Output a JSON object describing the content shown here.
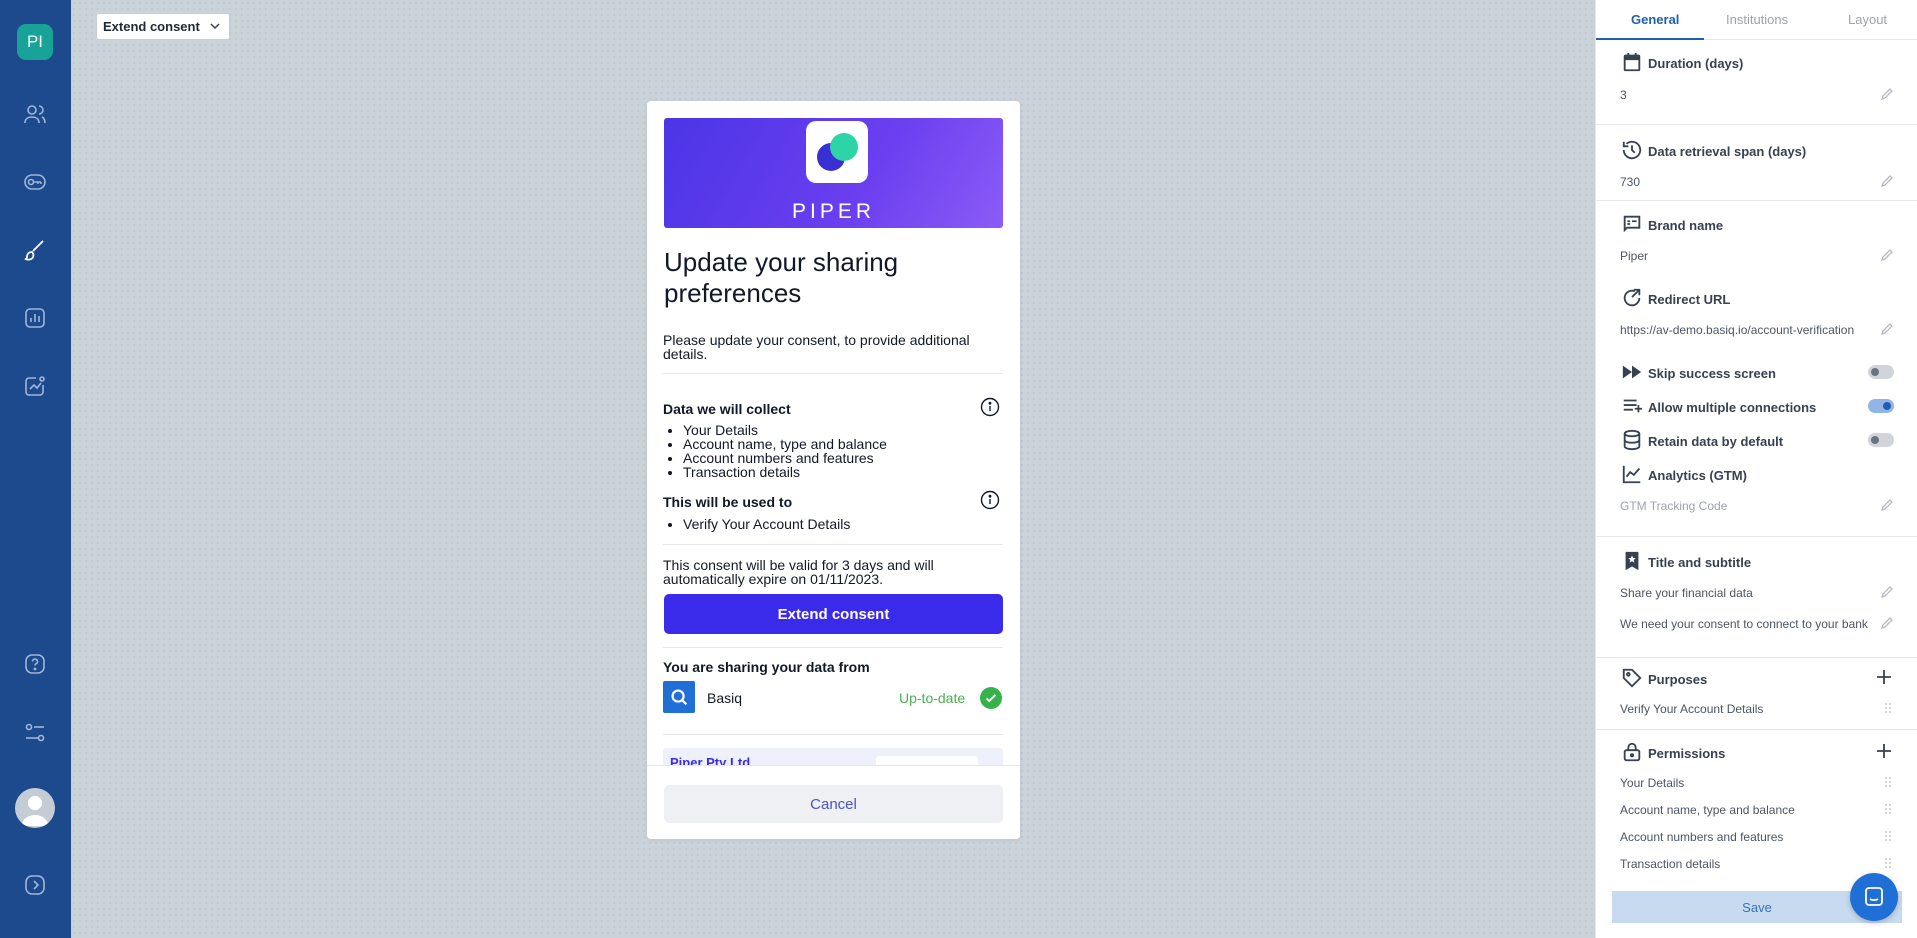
{
  "rail": {
    "org_initials": "PI",
    "items": [
      "users-icon",
      "key-icon",
      "brush-icon",
      "report-icon",
      "analytics-icon"
    ],
    "bottom": [
      "help-icon",
      "settings-sliders-icon",
      "avatar",
      "expand-icon"
    ]
  },
  "canvas": {
    "flow_select": "Extend consent"
  },
  "preview": {
    "brand_text": "PIPER",
    "title": "Update your sharing preferences",
    "intro": "Please update your consent, to provide additional details.",
    "collect_title": "Data we will collect",
    "collect_items": [
      "Your Details",
      "Account name, type and balance",
      "Account numbers and features",
      "Transaction details"
    ],
    "used_title": "This will be used to",
    "used_items": [
      "Verify Your Account Details"
    ],
    "validity": "This consent will be valid for 3 days and will automatically expire on 01/11/2023.",
    "extend_button": "Extend consent",
    "sharing_title": "You are sharing your data from",
    "institution": "Basiq",
    "institution_status": "Up-to-date",
    "partner_name": "Piper Pty Ltd",
    "cancel_button": "Cancel"
  },
  "panel": {
    "tabs": [
      "General",
      "Institutions",
      "Layout"
    ],
    "active_tab": "General",
    "duration_label": "Duration (days)",
    "duration_value": "3",
    "retrieval_label": "Data retrieval span (days)",
    "retrieval_value": "730",
    "brand_label": "Brand name",
    "brand_value": "Piper",
    "redirect_label": "Redirect URL",
    "redirect_value": "https://av-demo.basiq.io/account-verification",
    "skip_label": "Skip success screen",
    "skip_on": false,
    "multiple_label": "Allow multiple connections",
    "multiple_on": true,
    "retain_label": "Retain data by default",
    "retain_on": false,
    "analytics_label": "Analytics (GTM)",
    "analytics_placeholder": "GTM Tracking Code",
    "title_label": "Title and subtitle",
    "title_value": "Share your financial data",
    "subtitle_value": "We need your consent to connect to your bank",
    "purposes_label": "Purposes",
    "purposes": [
      "Verify Your Account Details"
    ],
    "permissions_label": "Permissions",
    "permissions": [
      "Your Details",
      "Account name, type and balance",
      "Account numbers and features",
      "Transaction details"
    ],
    "save_button": "Save"
  },
  "colors": {
    "rail": "#1d4a8c",
    "primary_button": "#3a2bea",
    "success": "#36b24a",
    "accent_tab": "#1f5fb0"
  }
}
